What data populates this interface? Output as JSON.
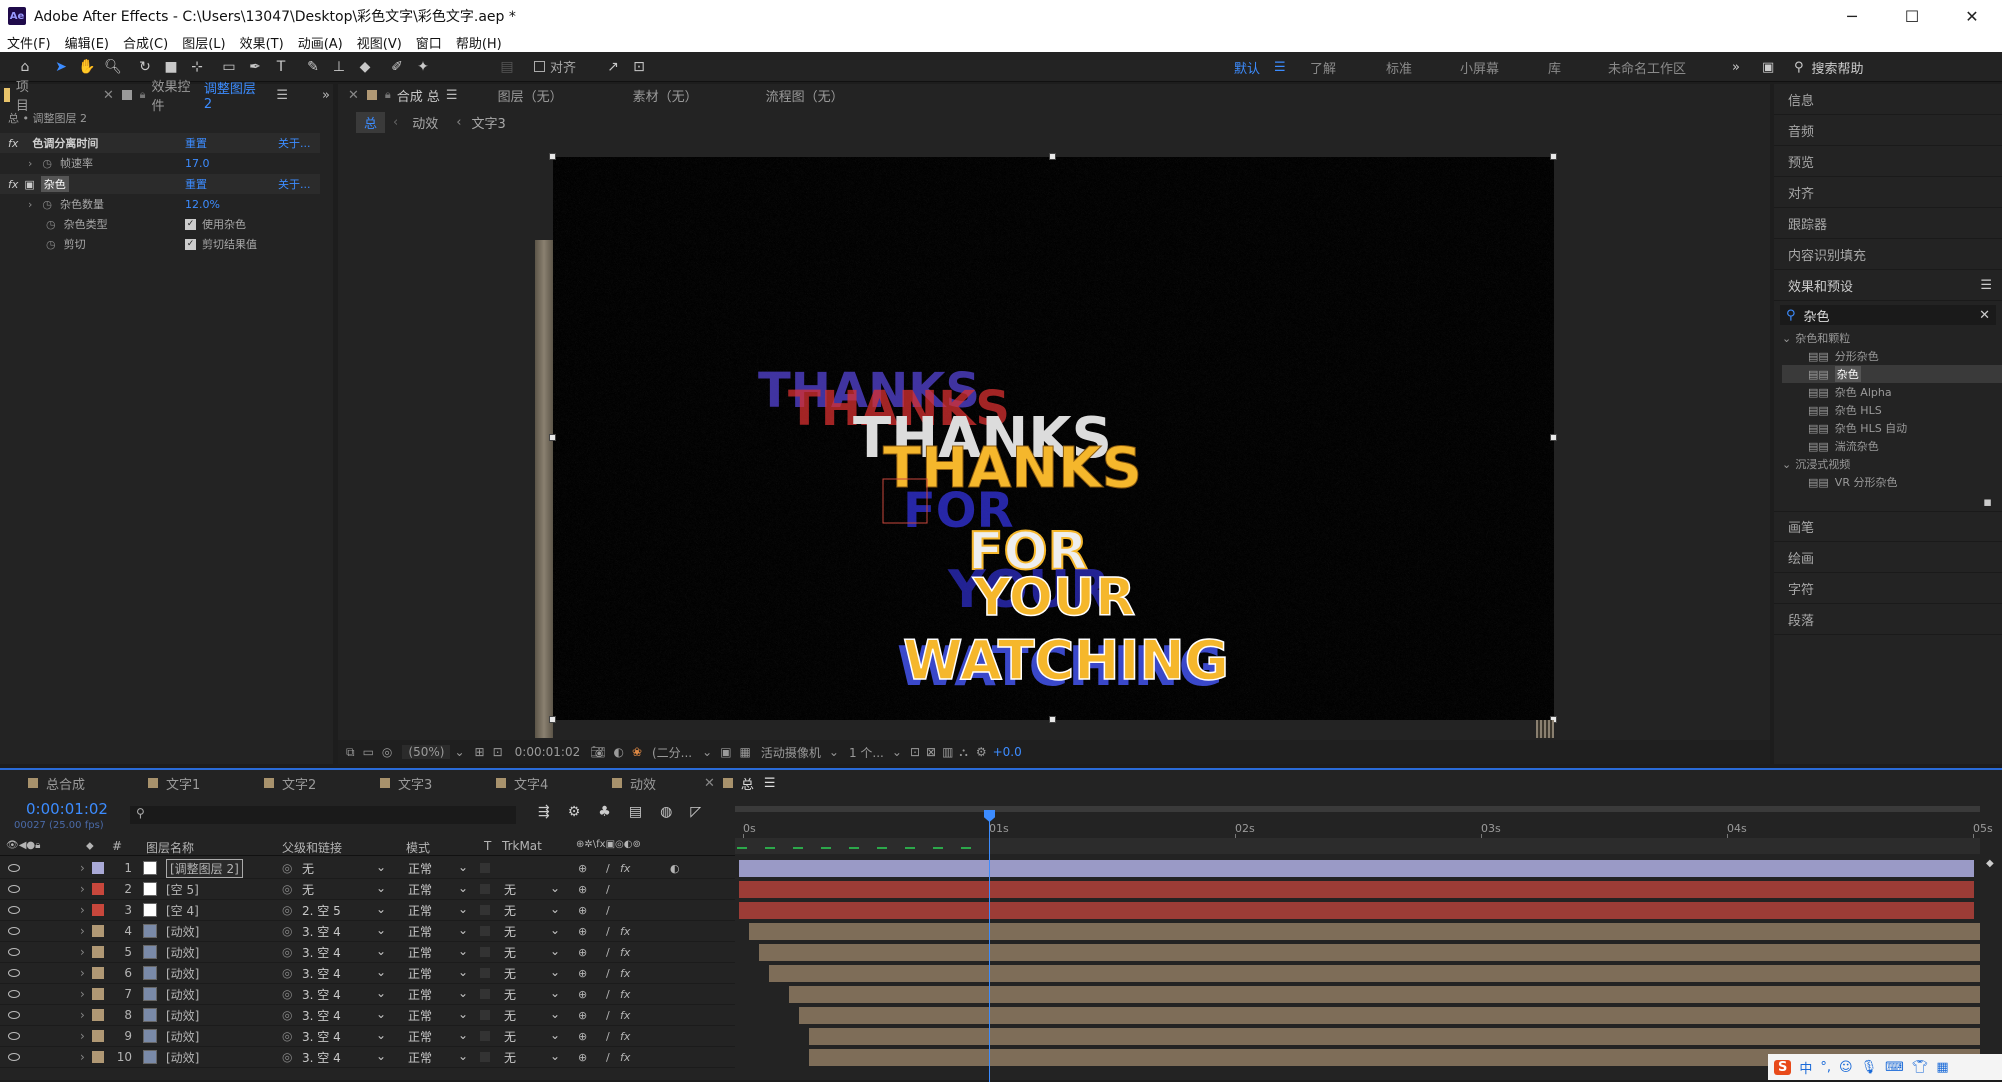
{
  "window": {
    "title": "Adobe After Effects - C:\\Users\\13047\\Desktop\\彩色文字\\彩色文字.aep *",
    "logo": "Ae",
    "min": "─",
    "max": "☐",
    "close": "✕"
  },
  "menu": [
    "文件(F)",
    "编辑(E)",
    "合成(C)",
    "图层(L)",
    "效果(T)",
    "动画(A)",
    "视图(V)",
    "窗口",
    "帮助(H)"
  ],
  "toolbar": {
    "align_label": "对齐",
    "search_placeholder": "搜索帮助"
  },
  "workspaces": [
    "默认",
    "了解",
    "标准",
    "小屏幕",
    "库",
    "未命名工作区"
  ],
  "left_panel": {
    "tab_project": "项目",
    "tab_effects": "效果控件",
    "tab_effects_layer": "调整图层 2",
    "breadcrumb": "总 • 调整图层 2",
    "effects": [
      {
        "fx": "fx",
        "name": "色调分离时间",
        "reset": "重置",
        "about": "关于..."
      },
      {
        "fx": "fx",
        "name": "杂色",
        "reset": "重置",
        "about": "关于..."
      }
    ],
    "props": [
      {
        "name": "帧速率",
        "value": "17.0"
      },
      {
        "name": "杂色数量",
        "value": "12.0%"
      },
      {
        "name": "杂色类型",
        "value": "使用杂色"
      },
      {
        "name": "剪切",
        "value": "剪切结果值"
      }
    ]
  },
  "viewer": {
    "tabs": [
      "合成 总",
      "图层（无）",
      "素材（无）",
      "流程图（无）"
    ],
    "nav": [
      "总",
      "动效",
      "文字3"
    ],
    "art_lines": [
      "THANKS",
      "FOR",
      "YOUR",
      "WATCHING"
    ],
    "zoom": "(50%)",
    "timecode": "0:00:01:02",
    "resolution": "(二分...",
    "camera": "活动摄像机",
    "views": "1 个...",
    "exposure": "+0.0"
  },
  "right_panel": {
    "panels": [
      "信息",
      "音频",
      "预览",
      "对齐",
      "跟踪器",
      "内容识别填充",
      "效果和预设"
    ],
    "search_value": "杂色",
    "groups": [
      {
        "name": "杂色和颗粒",
        "items": [
          "分形杂色",
          "杂色",
          "杂色 Alpha",
          "杂色 HLS",
          "杂色 HLS 自动",
          "湍流杂色"
        ]
      },
      {
        "name": "沉浸式视频",
        "items": [
          "VR 分形杂色"
        ]
      }
    ],
    "bottom_panels": [
      "画笔",
      "绘画",
      "字符",
      "段落"
    ]
  },
  "timeline": {
    "tabs": [
      "总合成",
      "文字1",
      "文字2",
      "文字3",
      "文字4",
      "动效",
      "总"
    ],
    "tab_colors": [
      "#a8926c",
      "#a8926c",
      "#a8926c",
      "#a8926c",
      "#a8926c",
      "#a8926c",
      "#a8926c"
    ],
    "timecode": "0:00:01:02",
    "fps": "00027 (25.00 fps)",
    "headers": {
      "num": "#",
      "name": "图层名称",
      "parent": "父级和链接",
      "mode": "模式",
      "t": "T",
      "trkmat": "TrkMat"
    },
    "ruler": [
      "0s",
      "01s",
      "02s",
      "03s",
      "04s",
      "05s"
    ],
    "layers": [
      {
        "num": "1",
        "name": "[调整图层 2]",
        "parent": "无",
        "mode": "正常",
        "trk": "",
        "color": "#a9a9d6",
        "barcolor": "#9a9ac6",
        "start": 0.0
      },
      {
        "num": "2",
        "name": "[空 5]",
        "parent": "无",
        "mode": "正常",
        "trk": "无",
        "color": "#c8473c",
        "barcolor": "#9c3c36",
        "start": 0.0
      },
      {
        "num": "3",
        "name": "[空 4]",
        "parent": "2. 空 5",
        "mode": "正常",
        "trk": "无",
        "color": "#c8473c",
        "barcolor": "#9c3c36",
        "start": 0.0
      },
      {
        "num": "4",
        "name": "[动效]",
        "parent": "3. 空 4",
        "mode": "正常",
        "trk": "无",
        "color": "#b09874",
        "barcolor": "#7e6d58",
        "start": 0.04
      },
      {
        "num": "5",
        "name": "[动效]",
        "parent": "3. 空 4",
        "mode": "正常",
        "trk": "无",
        "color": "#b09874",
        "barcolor": "#7e6d58",
        "start": 0.08
      },
      {
        "num": "6",
        "name": "[动效]",
        "parent": "3. 空 4",
        "mode": "正常",
        "trk": "无",
        "color": "#b09874",
        "barcolor": "#7e6d58",
        "start": 0.12
      },
      {
        "num": "7",
        "name": "[动效]",
        "parent": "3. 空 4",
        "mode": "正常",
        "trk": "无",
        "color": "#b09874",
        "barcolor": "#7e6d58",
        "start": 0.2
      },
      {
        "num": "8",
        "name": "[动效]",
        "parent": "3. 空 4",
        "mode": "正常",
        "trk": "无",
        "color": "#b09874",
        "barcolor": "#7e6d58",
        "start": 0.24
      },
      {
        "num": "9",
        "name": "[动效]",
        "parent": "3. 空 4",
        "mode": "正常",
        "trk": "无",
        "color": "#b09874",
        "barcolor": "#7e6d58",
        "start": 0.28
      },
      {
        "num": "10",
        "name": "[动效]",
        "parent": "3. 空 4",
        "mode": "正常",
        "trk": "无",
        "color": "#b09874",
        "barcolor": "#7e6d58",
        "start": 0.28
      }
    ],
    "playhead_seconds": 1.08,
    "duration_seconds": 5
  },
  "taskbar": {
    "ime": "中",
    "punct": "°,"
  }
}
